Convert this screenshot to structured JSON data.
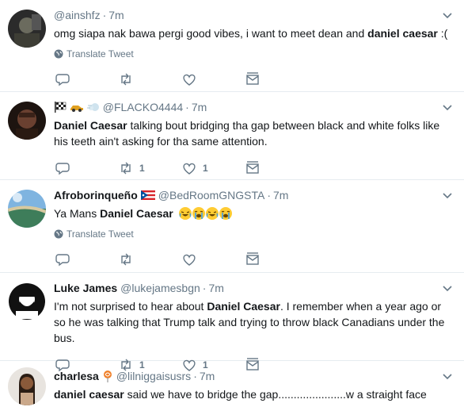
{
  "tweets": [
    {
      "name": "",
      "handle": "@ainshfz",
      "time": "7m",
      "text_parts": [
        "omg siapa nak bawa pergi good vibes, i want to meet dean and ",
        "daniel caesar",
        " :("
      ],
      "translate": "Translate Tweet",
      "replies": "",
      "retweets": "",
      "likes": ""
    },
    {
      "name": "",
      "handle": "@FLACKO4444",
      "time": "7m",
      "text_parts": [
        "Daniel Caesar",
        " talking bout bridging tha gap between black and white folks like his teeth ain't asking for tha same attention."
      ],
      "retweets": "1",
      "likes": "1"
    },
    {
      "name": "Afroborinqueño",
      "handle": "@BedRoomGNGSTA",
      "time": "7m",
      "text_parts": [
        "Ya Mans ",
        "Daniel Caesar"
      ],
      "translate": "Translate Tweet"
    },
    {
      "name": "Luke James",
      "handle": "@lukejamesbgn",
      "time": "7m",
      "text_parts": [
        "I'm not surprised to hear about ",
        "Daniel Caesar",
        ". I remember when a year ago or so he was talking that Trump talk and trying to throw black Canadians under the bus."
      ],
      "retweets": "1",
      "likes": "1"
    },
    {
      "name": "charlesa",
      "handle": "@lilniggaisusrs",
      "time": "7m",
      "text_parts": [
        "daniel caesar",
        " said we have to bridge the gap......................w a straight face"
      ]
    }
  ],
  "dot": "·",
  "icons": {
    "reply": "reply-icon",
    "retweet": "retweet-icon",
    "like": "heart-icon",
    "dm": "message-icon",
    "globe": "globe-icon",
    "caret": "chevron-down-icon"
  },
  "colors": {
    "text": "#14171a",
    "muted": "#657786",
    "border": "#e6ecf0"
  }
}
